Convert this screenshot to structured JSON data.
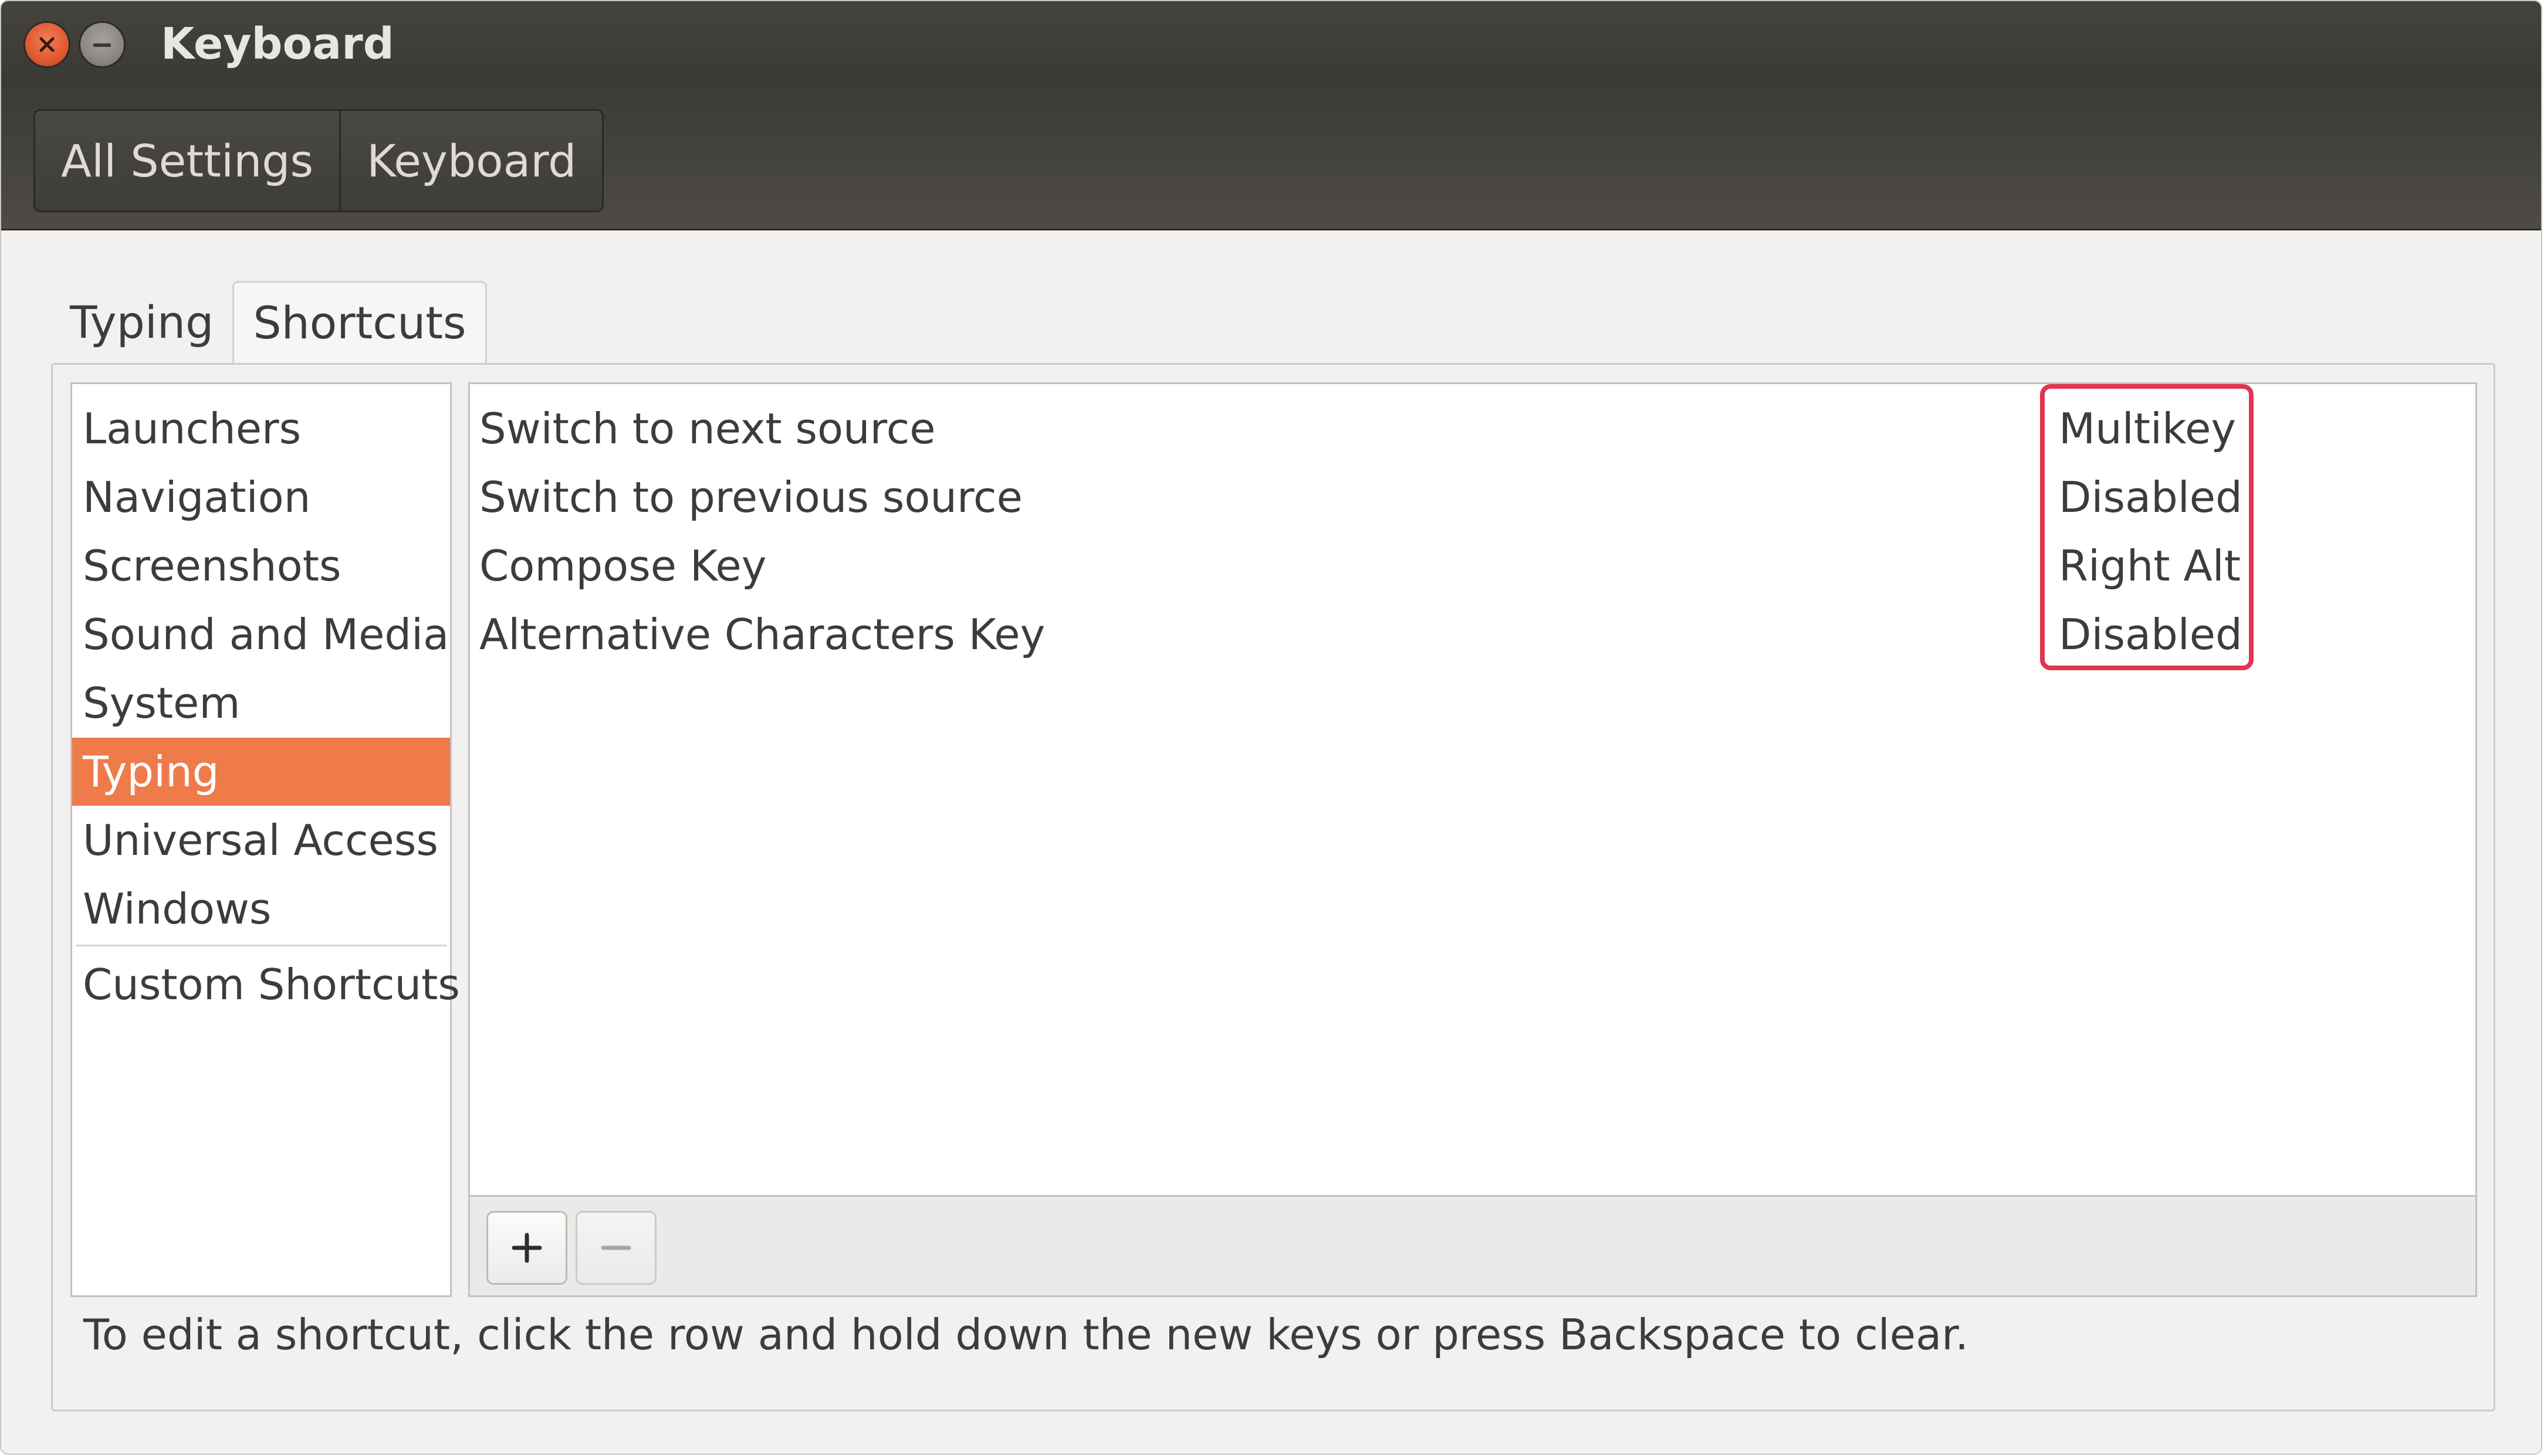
{
  "window": {
    "title": "Keyboard"
  },
  "breadcrumbs": [
    {
      "label": "All Settings"
    },
    {
      "label": "Keyboard"
    }
  ],
  "tabs": [
    {
      "label": "Typing",
      "active": false
    },
    {
      "label": "Shortcuts",
      "active": true
    }
  ],
  "sidebar": {
    "items": [
      {
        "label": "Launchers"
      },
      {
        "label": "Navigation"
      },
      {
        "label": "Screenshots"
      },
      {
        "label": "Sound and Media"
      },
      {
        "label": "System"
      },
      {
        "label": "Typing",
        "selected": true
      },
      {
        "label": "Universal Access"
      },
      {
        "label": "Windows"
      },
      {
        "label": "Custom Shortcuts"
      }
    ]
  },
  "shortcuts": [
    {
      "name": "Switch to next source",
      "accel": "Multikey"
    },
    {
      "name": "Switch to previous source",
      "accel": "Disabled"
    },
    {
      "name": "Compose Key",
      "accel": "Right Alt"
    },
    {
      "name": "Alternative Characters Key",
      "accel": "Disabled"
    }
  ],
  "list_toolbar": {
    "add_icon": "plus-icon",
    "remove_icon": "minus-icon",
    "remove_enabled": false
  },
  "hint": "To edit a shortcut, click the row and hold down the new keys or press Backspace to clear.",
  "colors": {
    "selection": "#ef7a4a",
    "highlight_box": "#e0364f",
    "titlebar": "#3c3b37"
  }
}
